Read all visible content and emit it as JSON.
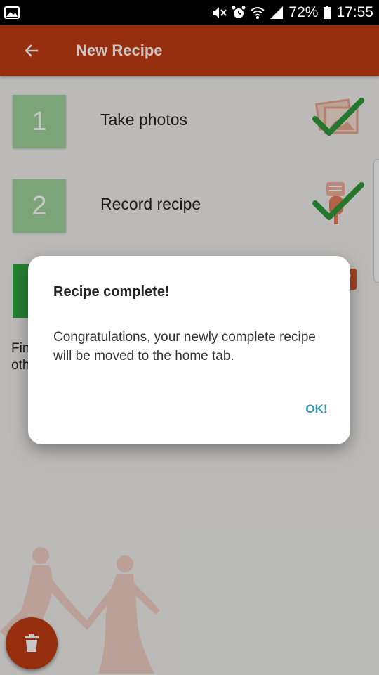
{
  "status_bar": {
    "battery": "72%",
    "time": "17:55",
    "icons": [
      "image-icon",
      "mute-icon",
      "alarm-icon",
      "wifi-icon",
      "signal-icon",
      "battery-icon"
    ]
  },
  "app_bar": {
    "title": "New Recipe",
    "back_icon": "arrow-left-icon"
  },
  "steps": [
    {
      "number": "1",
      "label": "Take photos",
      "icon": "photos-icon",
      "status_icon": "check-icon"
    },
    {
      "number": "2",
      "label": "Record recipe",
      "icon": "microphone-icon",
      "status_icon": "check-icon"
    },
    {
      "number": "",
      "label": "",
      "icon": "tag-icon"
    }
  ],
  "partial_text": {
    "line1": "Fin",
    "line2": "oth"
  },
  "fab": {
    "icon": "trash-icon"
  },
  "dialog": {
    "title": "Recipe complete!",
    "message": "Congratulations, your newly complete recipe will be moved to the home tab.",
    "ok_label": "OK!"
  },
  "colors": {
    "primary": "#c23b12",
    "step_done": "#9ed39b",
    "step_active": "#2ea43b",
    "check": "#2e9a3c",
    "dialog_button": "#3a9bb0"
  }
}
